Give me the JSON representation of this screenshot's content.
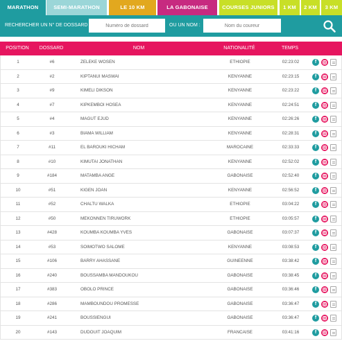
{
  "tabs": [
    {
      "label": "MARATHON"
    },
    {
      "label": "SEMI-MARATHON"
    },
    {
      "label": "LE 10 KM"
    },
    {
      "label": "LA GABONAISE"
    },
    {
      "label": "COURSES JUNIORS"
    },
    {
      "label": "1 KM"
    },
    {
      "label": "2 KM"
    },
    {
      "label": "3 KM"
    }
  ],
  "search": {
    "dossard_label": "RECHERCHER UN N° DE DOSSARD :",
    "dossard_placeholder": "Numéro de dossard",
    "nom_label": "OU UN NOM :",
    "nom_placeholder": "Nom du coureur",
    "icon": "search-icon"
  },
  "table": {
    "headers": {
      "position": "POSITION",
      "dossard": "DOSSARD",
      "nom": "NOM",
      "nationalite": "NATIONALITÉ",
      "temps": "TEMPS"
    },
    "rows": [
      {
        "position": "1",
        "dossard": "#6",
        "nom": "ZELEKE WOSEN",
        "nationalite": "ETHIOPIE",
        "temps": "02:23:02"
      },
      {
        "position": "2",
        "dossard": "#2",
        "nom": "KIPTANUI MASWAI",
        "nationalite": "KENYANNE",
        "temps": "02:23:15"
      },
      {
        "position": "3",
        "dossard": "#9",
        "nom": "KIMELI DIKSON",
        "nationalite": "KENYANNE",
        "temps": "02:23:22"
      },
      {
        "position": "4",
        "dossard": "#7",
        "nom": "KIPKEMBOI HOSEA",
        "nationalite": "KENYANNE",
        "temps": "02:24:51"
      },
      {
        "position": "5",
        "dossard": "#4",
        "nom": "MAGUT EJUD",
        "nationalite": "KENYANNE",
        "temps": "02:26:26"
      },
      {
        "position": "6",
        "dossard": "#3",
        "nom": "BIAMA WILLIAM",
        "nationalite": "KENYANNE",
        "temps": "02:28:31"
      },
      {
        "position": "7",
        "dossard": "#11",
        "nom": "EL BAROUKI HICHAM",
        "nationalite": "MAROCAINE",
        "temps": "02:33:33"
      },
      {
        "position": "8",
        "dossard": "#10",
        "nom": "KIMUTAI JONATHAN",
        "nationalite": "KENYANNE",
        "temps": "02:52:02"
      },
      {
        "position": "9",
        "dossard": "#184",
        "nom": "MATAMBA ANGE",
        "nationalite": "GABONAISE",
        "temps": "02:52:40"
      },
      {
        "position": "10",
        "dossard": "#51",
        "nom": "KIGEN JOAN",
        "nationalite": "KENYANNE",
        "temps": "02:56:52"
      },
      {
        "position": "11",
        "dossard": "#52",
        "nom": "CHALTU WALKA",
        "nationalite": "ETHIOPIE",
        "temps": "03:04:22"
      },
      {
        "position": "12",
        "dossard": "#50",
        "nom": "MEKONNEN TIRUWORK",
        "nationalite": "ETHIOPIE",
        "temps": "03:05:57"
      },
      {
        "position": "13",
        "dossard": "#428",
        "nom": "KOUMBA KOUMBA YVES",
        "nationalite": "GABONAISE",
        "temps": "03:07:37"
      },
      {
        "position": "14",
        "dossard": "#53",
        "nom": "SOIMOTWO SALOME",
        "nationalite": "KENYANNE",
        "temps": "03:08:53"
      },
      {
        "position": "15",
        "dossard": "#106",
        "nom": "BARRY AHASSANE",
        "nationalite": "GUINEENNE",
        "temps": "03:38:42"
      },
      {
        "position": "16",
        "dossard": "#240",
        "nom": "BOUSSAMBA MANDOUKOU",
        "nationalite": "GABONAISE",
        "temps": "03:38:45"
      },
      {
        "position": "17",
        "dossard": "#383",
        "nom": "OBOLO PRINCE",
        "nationalite": "GABONAISE",
        "temps": "03:36:46"
      },
      {
        "position": "18",
        "dossard": "#286",
        "nom": "MAMBOUNDOU PROMESSE",
        "nationalite": "GABONAISE",
        "temps": "03:36:47"
      },
      {
        "position": "19",
        "dossard": "#241",
        "nom": "BOUSSIENGUI",
        "nationalite": "GABONAISE",
        "temps": "03:36:47"
      },
      {
        "position": "20",
        "dossard": "#143",
        "nom": "DUDOUIT JOAQUIM",
        "nationalite": "FRANCAISE",
        "temps": "03:41:16"
      }
    ],
    "row_icons": [
      "facebook-icon",
      "instagram-icon",
      "document-icon"
    ]
  },
  "colors": {
    "teal": "#1f9ca0",
    "teal_light": "#9bd6d8",
    "orange": "#e2a81e",
    "magenta": "#c72a80",
    "lime": "#c8df27",
    "pink_header": "#e6155f"
  }
}
